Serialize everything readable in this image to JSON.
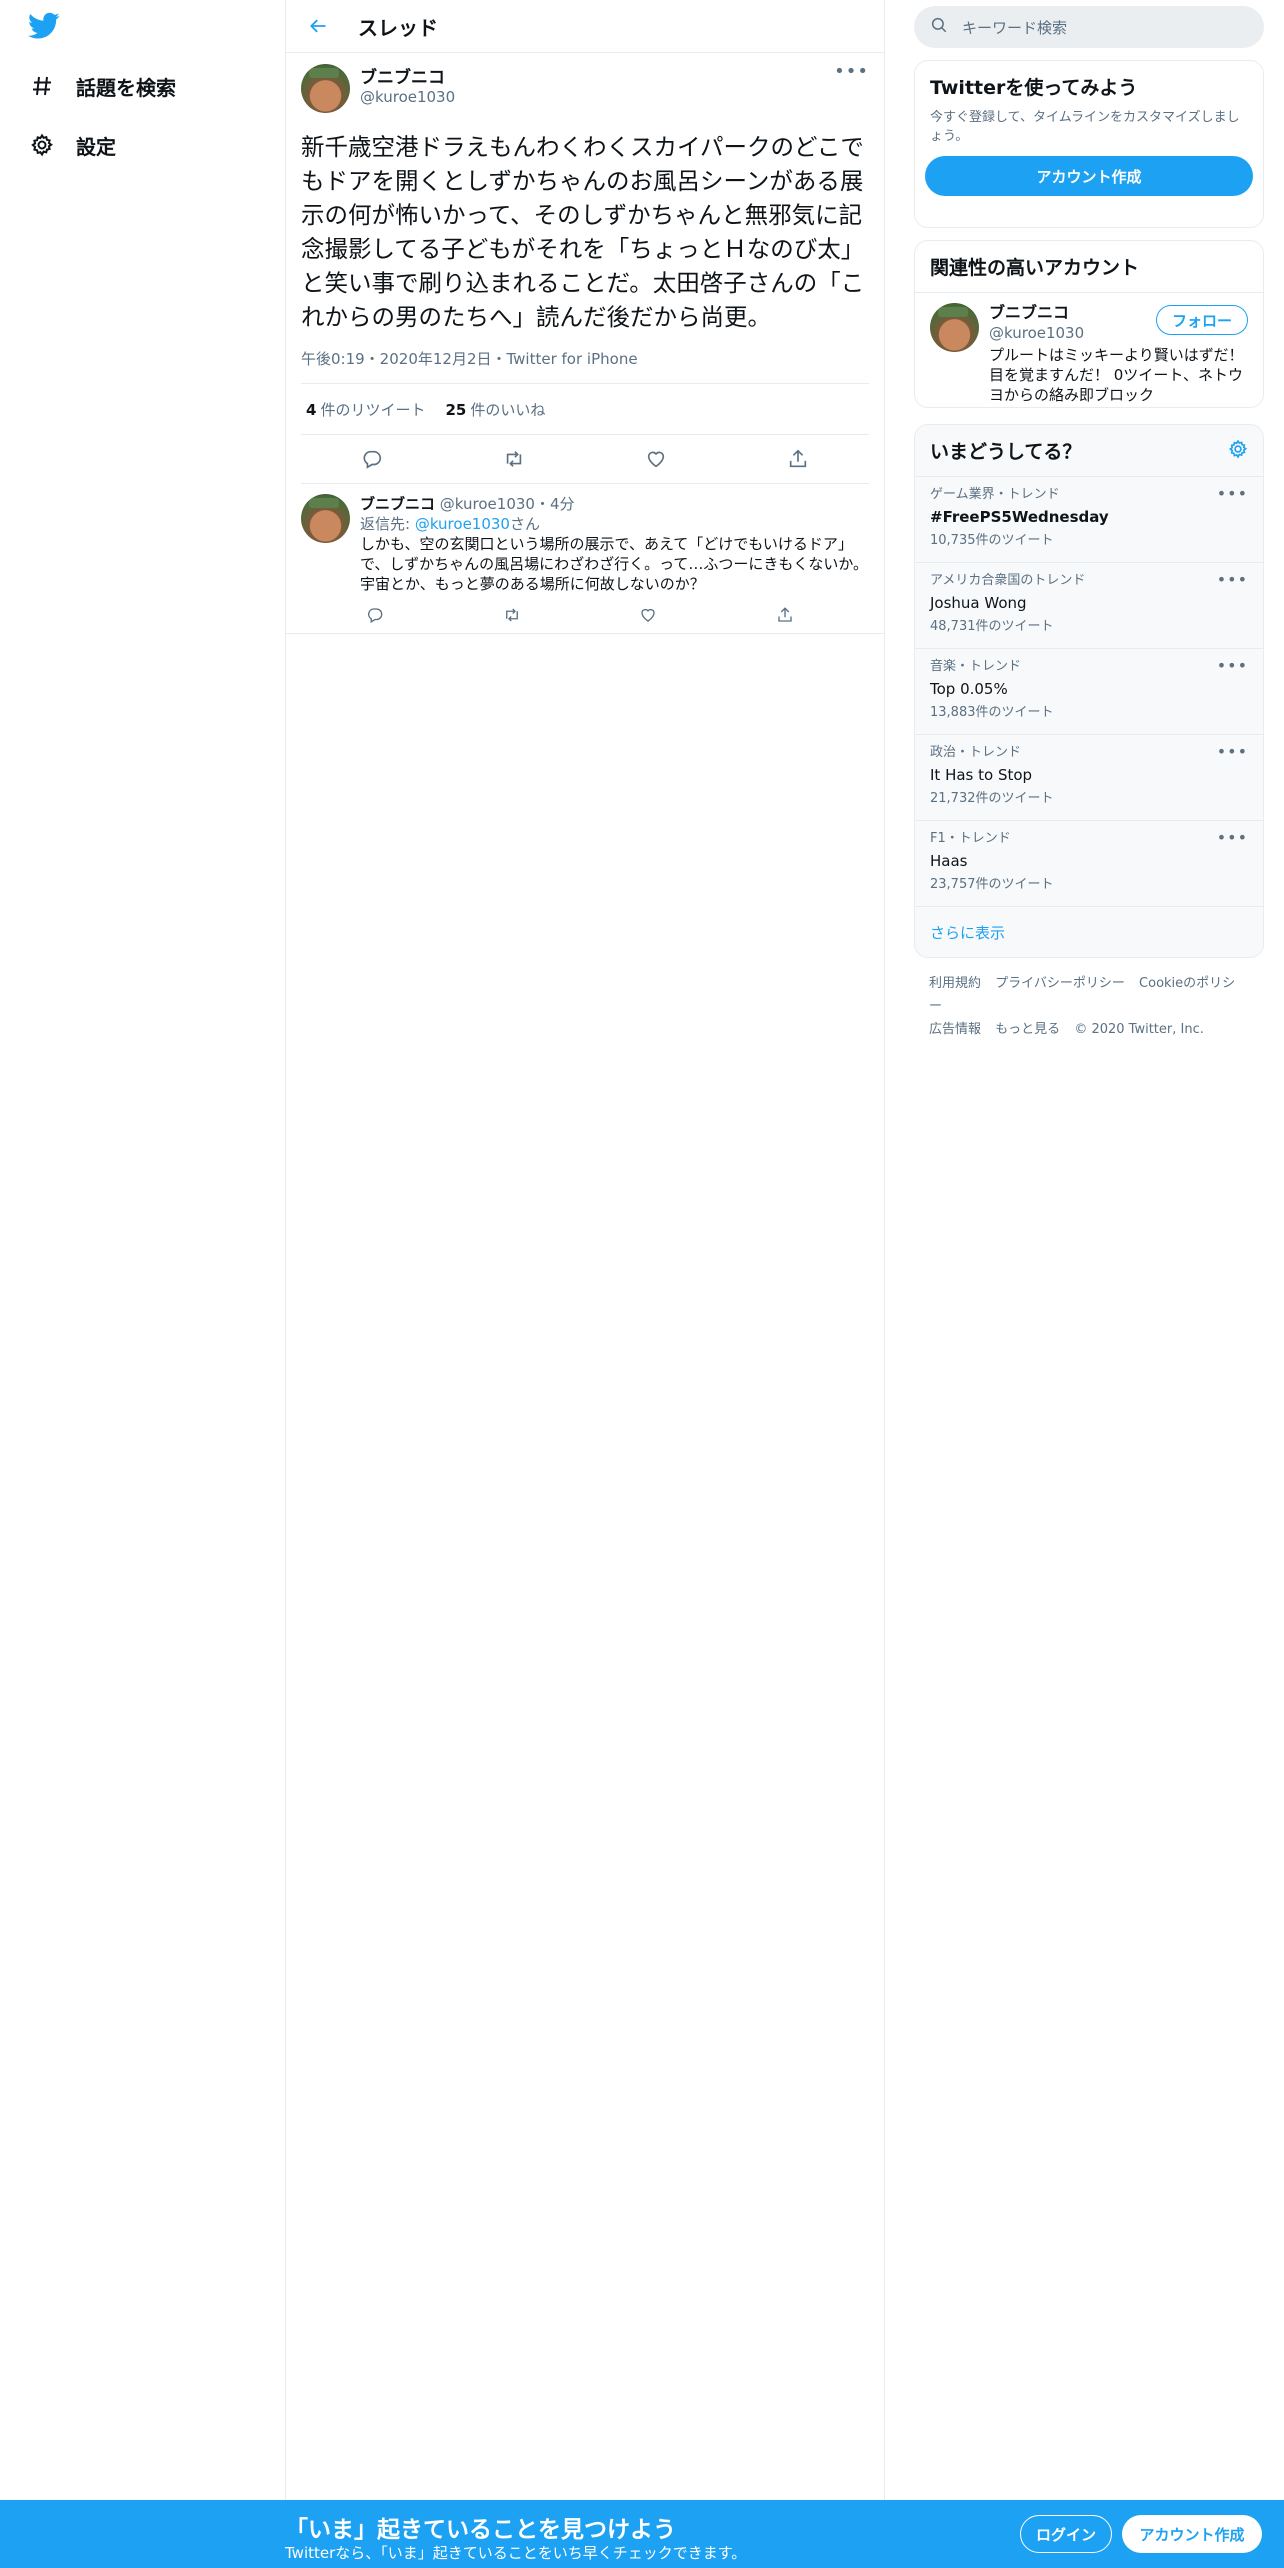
{
  "nav": {
    "logo": "twitter-bird",
    "explore_label": "話題を検索",
    "settings_label": "設定"
  },
  "header": {
    "title": "スレッド"
  },
  "tweet": {
    "author_name": "ブニブニコ",
    "author_handle": "@kuroe1030",
    "text": "新千歳空港ドラえもんわくわくスカイパークのどこでもドアを開くとしずかちゃんのお風呂シーンがある展示の何が怖いかって、そのしずかちゃんと無邪気に記念撮影してる子どもがそれを「ちょっとＨなのび太」と笑い事で刷り込まれることだ。太田啓子さんの「これからの男のたちへ」読んだ後だから尚更。",
    "meta": "午後0:19・2020年12月2日・Twitter for iPhone",
    "retweets_count": "4",
    "retweets_label": "件のリツイート",
    "likes_count": "25",
    "likes_label": "件のいいね"
  },
  "reply": {
    "author_name": "ブニブニコ",
    "author_handle": "@kuroe1030",
    "time": "・4分",
    "replying_prefix": "返信先: ",
    "replying_mention": "@kuroe1030",
    "replying_suffix": "さん",
    "text": "しかも、空の玄関口という場所の展示で、あえて「どけでもいけるドア」で、しずかちゃんの風呂場にわざわざ行く。って…ふつーにきもくないか。宇宙とか、もっと夢のある場所に何故しないのか？"
  },
  "search": {
    "placeholder": "キーワード検索"
  },
  "signup_card": {
    "title": "Twitterを使ってみよう",
    "desc": "今すぐ登録して、タイムラインをカスタマイズしましょう。",
    "button": "アカウント作成"
  },
  "related": {
    "title": "関連性の高いアカウント",
    "name": "ブニブニコ",
    "handle": "@kuroe1030",
    "bio": "プルートはミッキーより賢いはずだ！目を覚ますんだ！ 0ツイート、ネトウヨからの絡み即ブロック",
    "follow": "フォロー"
  },
  "trends": {
    "title": "いまどうしてる？",
    "items": [
      {
        "category": "ゲーム業界・トレンド",
        "name": "#FreePS5Wednesday",
        "count": "10,735件のツイート"
      },
      {
        "category": "アメリカ合衆国のトレンド",
        "name": "Joshua Wong",
        "count": "48,731件のツイート"
      },
      {
        "category": "音楽・トレンド",
        "name": "Top 0.05%",
        "count": "13,883件のツイート"
      },
      {
        "category": "政治・トレンド",
        "name": "It Has to Stop",
        "count": "21,732件のツイート"
      },
      {
        "category": "F1・トレンド",
        "name": "Haas",
        "count": "23,757件のツイート"
      }
    ],
    "show_more": "さらに表示"
  },
  "footer": {
    "terms": "利用規約",
    "privacy": "プライバシーポリシー",
    "cookie": "Cookieのポリシー",
    "ads": "広告情報",
    "more": "もっと見る",
    "copyright": "© 2020 Twitter, Inc."
  },
  "bottom_bar": {
    "title": "「いま」起きていることを見つけよう",
    "subtitle": "Twitterなら、「いま」起きていることをいち早くチェックできます。",
    "login": "ログイン",
    "signup": "アカウント作成"
  },
  "colors": {
    "accent": "#1da1f2",
    "text": "#0f1419",
    "secondary": "#5b7083",
    "border": "#e6ecf0"
  }
}
